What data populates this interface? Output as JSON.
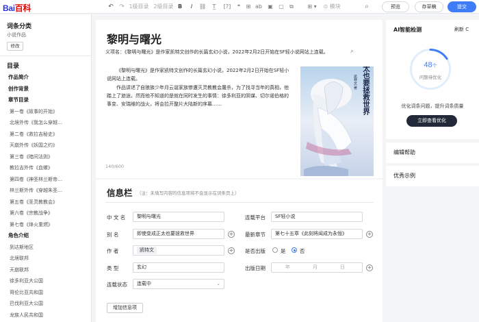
{
  "brand": {
    "logo_a": "Bai",
    "logo_b": "百科"
  },
  "toolbar": {
    "undo_icon": "undo-icon",
    "redo_icon": "redo-icon",
    "heading1": "1级目录",
    "heading2": "2级目录",
    "bold": "B",
    "italic": "I",
    "link": "🔗",
    "citation": "[?]",
    "quote": "❝",
    "table": "⊞",
    "strike": "ab",
    "image": "▣",
    "code": "</>",
    "insert": "⊞ ▾",
    "module": "⊙ 模块",
    "search": "⌕",
    "preview": "预览",
    "draft": "存草稿",
    "submit": "提交"
  },
  "sidebar": {
    "category_title": "词条分类",
    "category_value": "小说作品",
    "edit_button": "修改",
    "toc_title": "目录",
    "toc": [
      {
        "label": "作品简介",
        "heading": true
      },
      {
        "label": "创作背景",
        "heading": true
      },
      {
        "label": "章节目录",
        "heading": true
      },
      {
        "label": "第一卷《故事的开始》",
        "heading": false
      },
      {
        "label": "北境外传《我怎么穿越…",
        "heading": false
      },
      {
        "label": "第二卷《救拉吉秘史》",
        "heading": false
      },
      {
        "label": "天崩外传《妖国之约》",
        "heading": false
      },
      {
        "label": "第三卷《暗间法则》",
        "heading": false
      },
      {
        "label": "教拉吉外传《血螺》",
        "heading": false
      },
      {
        "label": "第四卷《神圣林兰斯帝…",
        "heading": false
      },
      {
        "label": "林兰斯外传《穿越朱圣…",
        "heading": false
      },
      {
        "label": "第五卷《圣灵教教会》",
        "heading": false
      },
      {
        "label": "第六卷《宗教战争》",
        "heading": false
      },
      {
        "label": "第七卷《烽火重燃》",
        "heading": false
      },
      {
        "label": "角色介绍",
        "heading": true
      },
      {
        "label": "到达斯地区",
        "heading": false
      },
      {
        "label": "北境联邦",
        "heading": false
      },
      {
        "label": "天崩联邦",
        "heading": false
      },
      {
        "label": "徐多利亚大公国",
        "heading": false
      },
      {
        "label": "哥伦比亚共和国",
        "heading": false
      },
      {
        "label": "巴伐利亚大公国",
        "heading": false
      },
      {
        "label": "龙族人民共和国",
        "heading": false
      },
      {
        "label": "罗莎王国",
        "heading": false
      }
    ]
  },
  "article": {
    "title": "黎明与曙光",
    "definition": "义项名：《黎明与曙光》是作家凯特文创作的长篇玄幻小说，2022年2月2日开始在SF轻小说网站上连载。",
    "definition_icon": "comment-icon",
    "para1": "《黎明与曙光》是作家凯特文创作的长篇玄幻小说，2022年2月2日开始在SF轻小说网站上连载。",
    "para2": "作品讲述了自狼族少年月云诞家族惨遭灭灵教教会屠杀，为了找寻当年的真相，他踏上了旅途。然而他不知道的是就在同时发生的事情：徐多利亚的阴谋、切尔诺伯格的事变、安瑞维的战火，将会拉开整片大陆新的序幕……",
    "cover_title": "即使变成正太也要拯救世界",
    "cover_author": "凯特文 著",
    "word_count": "140/600"
  },
  "infobox": {
    "title": "信息栏",
    "note": "（注：未填写内容的信息项将不会显示在词条页上）",
    "fields": {
      "chinese_name_label": "中 文 名",
      "chinese_name": "黎明与曙光",
      "platform_label": "连载平台",
      "platform": "SF轻小说",
      "alias_label": "别  名",
      "alias": "即使变成正太也要拯救世界",
      "latest_label": "最新章节",
      "latest": "第七十五章《此刻将闻成为永恒》",
      "author_label": "作  者",
      "author": "凯特文",
      "finished_label": "是否出版",
      "yes": "是",
      "no": "否",
      "selected": "否",
      "genre_label": "类  型",
      "genre": "玄幻",
      "pub_date_label": "出版日期",
      "year": "年",
      "month": "月",
      "day": "日",
      "status_label": "连载状态",
      "status": "连载中"
    },
    "add_button": "增加信息项"
  },
  "ai": {
    "title": "AI智能检测",
    "refresh": "刷新 C",
    "count": "48",
    "count_unit": "个",
    "count_label": "问题待优化",
    "score_fraction": 0.16,
    "description": "优化词条问题，提升词条质量",
    "button": "立即查看优化"
  },
  "help_title": "编辑帮助",
  "examples_title": "优秀示例",
  "colors": {
    "accent": "#3e7df7",
    "brand_red": "#e10602",
    "brand_blue": "#2932e1",
    "dark_button": "#222a3a"
  }
}
